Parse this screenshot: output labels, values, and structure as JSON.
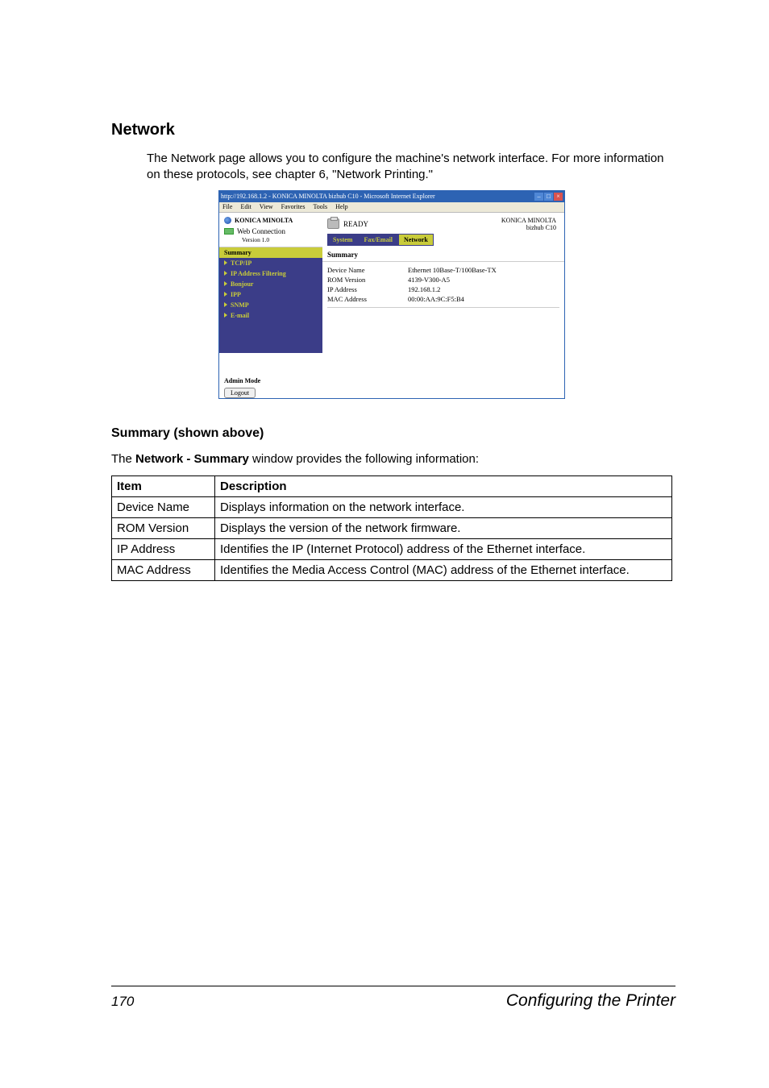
{
  "headings": {
    "network": "Network",
    "summary": "Summary (shown above)"
  },
  "intro": "The Network page allows you to configure the machine's network interface. For more information on these protocols, see chapter 6, \"Network Printing.\"",
  "screenshot": {
    "titlebar": "http://192.168.1.2 - KONICA MINOLTA bizhub C10 - Microsoft Internet Explorer",
    "menubar": [
      "File",
      "Edit",
      "View",
      "Favorites",
      "Tools",
      "Help"
    ],
    "brand": "KONICA MINOLTA",
    "webconn": "Web Connection",
    "version": "Version 1.0",
    "sidebar": [
      {
        "label": "Summary",
        "active": true
      },
      {
        "label": "TCP/IP"
      },
      {
        "label": "IP Address Filtering"
      },
      {
        "label": "Bonjour"
      },
      {
        "label": "IPP"
      },
      {
        "label": "SNMP"
      },
      {
        "label": "E-mail"
      }
    ],
    "admin_label": "Admin Mode",
    "logout": "Logout",
    "ready": "READY",
    "device_brand": "KONICA MINOLTA",
    "device_model": "bizhub C10",
    "tabs": [
      {
        "label": "System"
      },
      {
        "label": "Fax/Email"
      },
      {
        "label": "Network",
        "active": true
      }
    ],
    "panel_heading": "Summary",
    "rows": [
      {
        "k": "Device Name",
        "v": "Ethernet 10Base-T/100Base-TX"
      },
      {
        "k": "ROM Version",
        "v": "4139-V300-A5"
      },
      {
        "k": "IP Address",
        "v": "192.168.1.2"
      },
      {
        "k": "MAC Address",
        "v": "00:00:AA:9C:F5:B4"
      }
    ]
  },
  "table_intro_pre": "The ",
  "table_intro_bold": "Network - Summary",
  "table_intro_post": " window provides the following information:",
  "table": {
    "head": {
      "item": "Item",
      "desc": "Description"
    },
    "rows": [
      {
        "item": "Device Name",
        "desc": "Displays information on the network interface."
      },
      {
        "item": "ROM Version",
        "desc": "Displays the version of the network firmware."
      },
      {
        "item": "IP Address",
        "desc": "Identifies the IP (Internet Protocol) address of the Ethernet interface."
      },
      {
        "item": "MAC Address",
        "desc": "Identifies the Media Access Control (MAC) address of the Ethernet interface."
      }
    ]
  },
  "footer": {
    "page": "170",
    "title": "Configuring the Printer"
  }
}
